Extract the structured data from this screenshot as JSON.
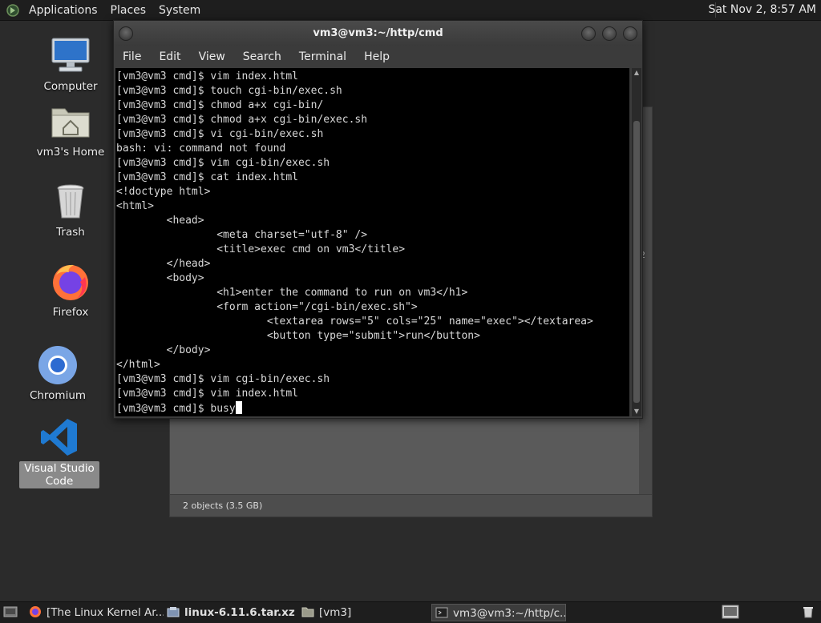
{
  "top_panel": {
    "menus": [
      "Applications",
      "Places",
      "System"
    ],
    "clock": "Sat Nov 2, 8:57 AM"
  },
  "desktop_icons": [
    {
      "label": "Computer",
      "icon": "computer-icon"
    },
    {
      "label": "vm3's Home",
      "icon": "home-folder-icon"
    },
    {
      "label": "Trash",
      "icon": "trash-icon"
    },
    {
      "label": "Firefox",
      "icon": "firefox-icon"
    },
    {
      "label": "Chromium",
      "icon": "chromium-icon"
    },
    {
      "label": "Visual Studio Code",
      "icon": "vscode-icon"
    }
  ],
  "terminal": {
    "title": "vm3@vm3:~/http/cmd",
    "menu": [
      "File",
      "Edit",
      "View",
      "Search",
      "Terminal",
      "Help"
    ],
    "lines": [
      "[vm3@vm3 cmd]$ vim index.html",
      "[vm3@vm3 cmd]$ touch cgi-bin/exec.sh",
      "[vm3@vm3 cmd]$ chmod a+x cgi-bin/",
      "[vm3@vm3 cmd]$ chmod a+x cgi-bin/exec.sh",
      "[vm3@vm3 cmd]$ vi cgi-bin/exec.sh",
      "bash: vi: command not found",
      "[vm3@vm3 cmd]$ vim cgi-bin/exec.sh",
      "[vm3@vm3 cmd]$ cat index.html",
      "<!doctype html>",
      "<html>",
      "        <head>",
      "                <meta charset=\"utf-8\" />",
      "                <title>exec cmd on vm3</title>",
      "        </head>",
      "        <body>",
      "                <h1>enter the command to run on vm3</h1>",
      "                <form action=\"/cgi-bin/exec.sh\">",
      "                        <textarea rows=\"5\" cols=\"25\" name=\"exec\"></textarea>",
      "                        <button type=\"submit\">run</button>",
      "        </body>",
      "</html>",
      "[vm3@vm3 cmd]$ vim cgi-bin/exec.sh",
      "[vm3@vm3 cmd]$ vim index.html"
    ],
    "prompt_line": "[vm3@vm3 cmd]$ busy"
  },
  "file_manager": {
    "status": "2 objects (3.5 GB)",
    "fragment": "2"
  },
  "taskbar": {
    "items": [
      {
        "label": "[The Linux Kernel Ar...",
        "icon": "firefox-icon"
      },
      {
        "label": "linux-6.11.6.tar.xz",
        "icon": "archive-manager-icon"
      },
      {
        "label": "[vm3]",
        "icon": "folder-icon"
      },
      {
        "label": "vm3@vm3:~/http/c...",
        "icon": "terminal-icon"
      }
    ]
  }
}
